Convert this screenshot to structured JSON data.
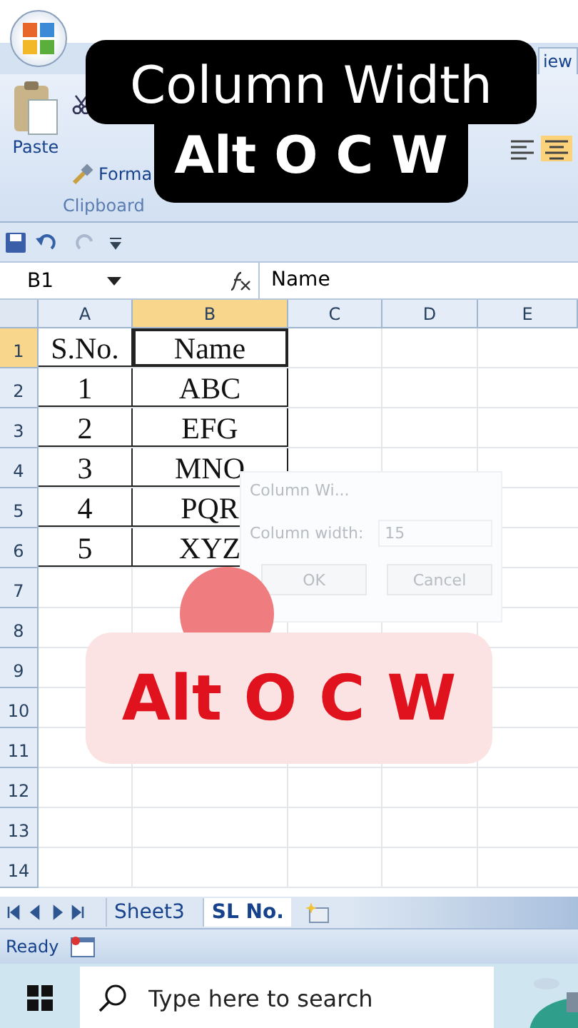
{
  "ribbon": {
    "tab_fragment": "iew",
    "paste_label": "Paste",
    "format_label": "Forma",
    "group_label": "Clipboard"
  },
  "title_overlay": {
    "line1": "Column Width",
    "line2": "Alt O C W"
  },
  "name_box": "B1",
  "formula": "Name",
  "columns": [
    {
      "label": "A",
      "selected": false
    },
    {
      "label": "B",
      "selected": true
    },
    {
      "label": "C",
      "selected": false
    },
    {
      "label": "D",
      "selected": false
    },
    {
      "label": "E",
      "selected": false
    }
  ],
  "rows": [
    {
      "label": "1",
      "selected": true
    },
    {
      "label": "2",
      "selected": false
    },
    {
      "label": "3",
      "selected": false
    },
    {
      "label": "4",
      "selected": false
    },
    {
      "label": "5",
      "selected": false
    },
    {
      "label": "6",
      "selected": false
    },
    {
      "label": "7",
      "selected": false
    },
    {
      "label": "8",
      "selected": false
    },
    {
      "label": "9",
      "selected": false
    },
    {
      "label": "10",
      "selected": false
    },
    {
      "label": "11",
      "selected": false
    },
    {
      "label": "12",
      "selected": false
    },
    {
      "label": "13",
      "selected": false
    },
    {
      "label": "14",
      "selected": false
    }
  ],
  "cells": [
    [
      "S.No.",
      "Name"
    ],
    [
      "1",
      "ABC"
    ],
    [
      "2",
      "EFG"
    ],
    [
      "3",
      "MNO"
    ],
    [
      "4",
      "PQR"
    ],
    [
      "5",
      "XYZ"
    ]
  ],
  "dialog": {
    "title": "Column Wi...",
    "label": "Column width:",
    "value": "15",
    "buttons": [
      "OK",
      "Cancel"
    ]
  },
  "shortcut_banner": "Alt O C W",
  "sheet_tabs": [
    {
      "label": "Sheet3",
      "selected": false
    },
    {
      "label": "SL No.",
      "selected": true
    }
  ],
  "status": "Ready",
  "taskbar": {
    "search_placeholder": "Type here to search"
  }
}
